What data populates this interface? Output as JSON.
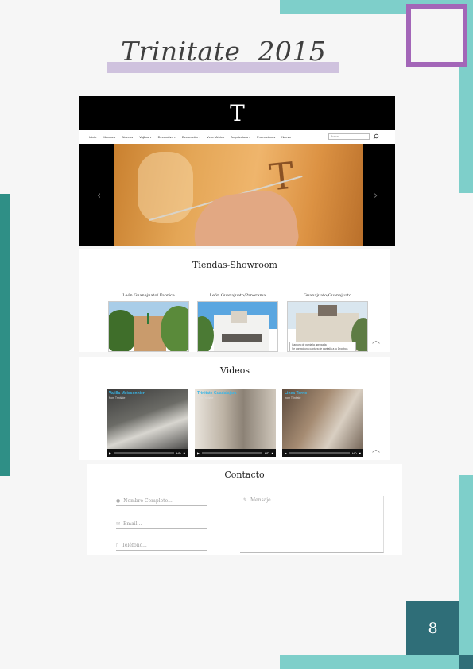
{
  "page": {
    "title": "Trinitate  2015",
    "page_number": "8"
  },
  "site": {
    "logo": "T",
    "nav": {
      "items": [
        "Inicio",
        "Marcas ▾",
        "Nuevos",
        "Vajillas ▾",
        "Decorativo ▾",
        "Decoración ▾",
        "Vera México",
        "Arquitectura ▾",
        "Promociones",
        "Nuevo"
      ],
      "search_placeholder": "Buscar..."
    }
  },
  "showroom": {
    "title": "Tiendas-Showroom",
    "stores": [
      {
        "label": "León Guanajuato/ Fabrica"
      },
      {
        "label": "León Guanajuato/Panorama"
      },
      {
        "label": "Guanajuato/Guanajuato"
      }
    ],
    "notice": {
      "line1": "Captura de pantalla agregada",
      "line2": "Se agregó una captura de pantalla a tu Dropbox."
    }
  },
  "videos": {
    "title": "Videos",
    "items": [
      {
        "title": "Vajilla Meissonnier",
        "sub": "from Trinitate"
      },
      {
        "title": "Trinitate Guadalajara",
        "sub": "from Trinitate"
      },
      {
        "title": "Linea Torno",
        "sub": "from Trinitate"
      }
    ],
    "hd": "HD"
  },
  "contact": {
    "title": "Contacto",
    "name_placeholder": "Nombre Completo...",
    "email_placeholder": "Email...",
    "phone_placeholder": "Teléfono...",
    "message_placeholder": "Mensaje..."
  },
  "colors": {
    "teal_light": "#7ecfca",
    "teal_dark": "#2f8f86",
    "navy_teal": "#2f6e78",
    "purple": "#a366b8",
    "lavender": "#cfc2de"
  }
}
